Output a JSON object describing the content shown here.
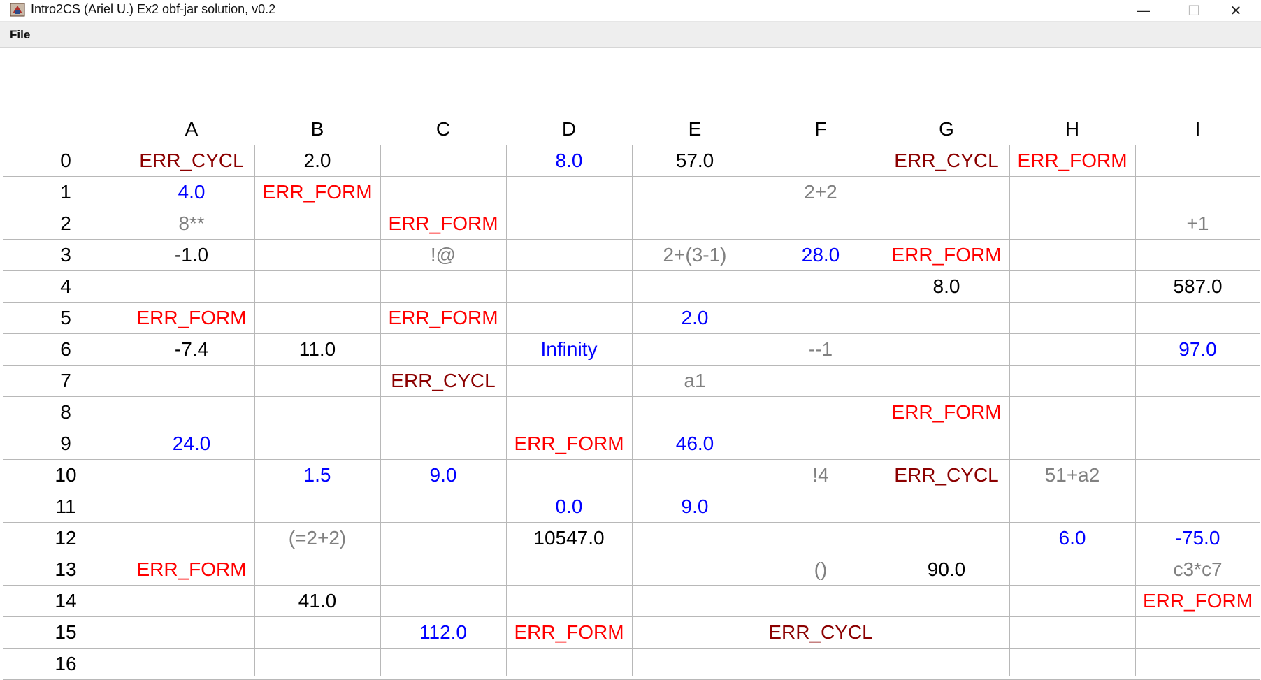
{
  "window": {
    "title": "Intro2CS (Ariel U.) Ex2 obf-jar solution, v0.2",
    "minimize_glyph": "—",
    "maximize_glyph": "☐",
    "close_glyph": "✕"
  },
  "menu": {
    "file_label": "File"
  },
  "grid": {
    "columns": [
      "A",
      "B",
      "C",
      "D",
      "E",
      "F",
      "G",
      "H",
      "I"
    ],
    "rows": [
      "0",
      "1",
      "2",
      "3",
      "4",
      "5",
      "6",
      "7",
      "8",
      "9",
      "10",
      "11",
      "12",
      "13",
      "14",
      "15",
      "16"
    ],
    "cells": [
      {
        "ref": "A0",
        "text": "ERR_CYCL",
        "kind": "errcycl"
      },
      {
        "ref": "B0",
        "text": "2.0",
        "kind": "num"
      },
      {
        "ref": "D0",
        "text": "8.0",
        "kind": "blue"
      },
      {
        "ref": "E0",
        "text": "57.0",
        "kind": "num"
      },
      {
        "ref": "G0",
        "text": "ERR_CYCL",
        "kind": "errcycl"
      },
      {
        "ref": "H0",
        "text": "ERR_FORM",
        "kind": "errform"
      },
      {
        "ref": "A1",
        "text": "4.0",
        "kind": "blue"
      },
      {
        "ref": "B1",
        "text": "ERR_FORM",
        "kind": "errform"
      },
      {
        "ref": "F1",
        "text": "2+2",
        "kind": "gray"
      },
      {
        "ref": "A2",
        "text": "8**",
        "kind": "gray"
      },
      {
        "ref": "C2",
        "text": "ERR_FORM",
        "kind": "errform"
      },
      {
        "ref": "I2",
        "text": "+1",
        "kind": "gray"
      },
      {
        "ref": "A3",
        "text": "-1.0",
        "kind": "num"
      },
      {
        "ref": "C3",
        "text": "!@",
        "kind": "gray"
      },
      {
        "ref": "E3",
        "text": "2+(3-1)",
        "kind": "gray"
      },
      {
        "ref": "F3",
        "text": "28.0",
        "kind": "blue"
      },
      {
        "ref": "G3",
        "text": "ERR_FORM",
        "kind": "errform"
      },
      {
        "ref": "G4",
        "text": "8.0",
        "kind": "num"
      },
      {
        "ref": "I4",
        "text": "587.0",
        "kind": "num"
      },
      {
        "ref": "A5",
        "text": "ERR_FORM",
        "kind": "errform"
      },
      {
        "ref": "C5",
        "text": "ERR_FORM",
        "kind": "errform"
      },
      {
        "ref": "E5",
        "text": "2.0",
        "kind": "blue"
      },
      {
        "ref": "A6",
        "text": "-7.4",
        "kind": "num"
      },
      {
        "ref": "B6",
        "text": "11.0",
        "kind": "num"
      },
      {
        "ref": "D6",
        "text": "Infinity",
        "kind": "blue"
      },
      {
        "ref": "F6",
        "text": "--1",
        "kind": "gray"
      },
      {
        "ref": "I6",
        "text": "97.0",
        "kind": "blue"
      },
      {
        "ref": "C7",
        "text": "ERR_CYCL",
        "kind": "errcycl"
      },
      {
        "ref": "E7",
        "text": "a1",
        "kind": "gray"
      },
      {
        "ref": "G8",
        "text": "ERR_FORM",
        "kind": "errform"
      },
      {
        "ref": "A9",
        "text": "24.0",
        "kind": "blue"
      },
      {
        "ref": "D9",
        "text": "ERR_FORM",
        "kind": "errform"
      },
      {
        "ref": "E9",
        "text": "46.0",
        "kind": "blue"
      },
      {
        "ref": "B10",
        "text": "1.5",
        "kind": "blue"
      },
      {
        "ref": "C10",
        "text": "9.0",
        "kind": "blue"
      },
      {
        "ref": "F10",
        "text": "!4",
        "kind": "gray"
      },
      {
        "ref": "G10",
        "text": "ERR_CYCL",
        "kind": "errcycl"
      },
      {
        "ref": "H10",
        "text": "51+a2",
        "kind": "gray"
      },
      {
        "ref": "D11",
        "text": "0.0",
        "kind": "blue"
      },
      {
        "ref": "E11",
        "text": "9.0",
        "kind": "blue"
      },
      {
        "ref": "B12",
        "text": "(=2+2)",
        "kind": "gray"
      },
      {
        "ref": "D12",
        "text": "10547.0",
        "kind": "num"
      },
      {
        "ref": "H12",
        "text": "6.0",
        "kind": "blue"
      },
      {
        "ref": "I12",
        "text": "-75.0",
        "kind": "blue"
      },
      {
        "ref": "A13",
        "text": "ERR_FORM",
        "kind": "errform"
      },
      {
        "ref": "F13",
        "text": "()",
        "kind": "gray"
      },
      {
        "ref": "G13",
        "text": "90.0",
        "kind": "num"
      },
      {
        "ref": "I13",
        "text": "c3*c7",
        "kind": "gray"
      },
      {
        "ref": "B14",
        "text": "41.0",
        "kind": "num"
      },
      {
        "ref": "I14",
        "text": "ERR_FORM",
        "kind": "errform"
      },
      {
        "ref": "C15",
        "text": "112.0",
        "kind": "blue"
      },
      {
        "ref": "D15",
        "text": "ERR_FORM",
        "kind": "errform"
      },
      {
        "ref": "F15",
        "text": "ERR_CYCL",
        "kind": "errcycl"
      }
    ]
  },
  "colors": {
    "number": "#000000",
    "computed": "#0000ff",
    "text": "#808080",
    "err_cycl": "#8b0000",
    "err_form": "#ff0000"
  }
}
